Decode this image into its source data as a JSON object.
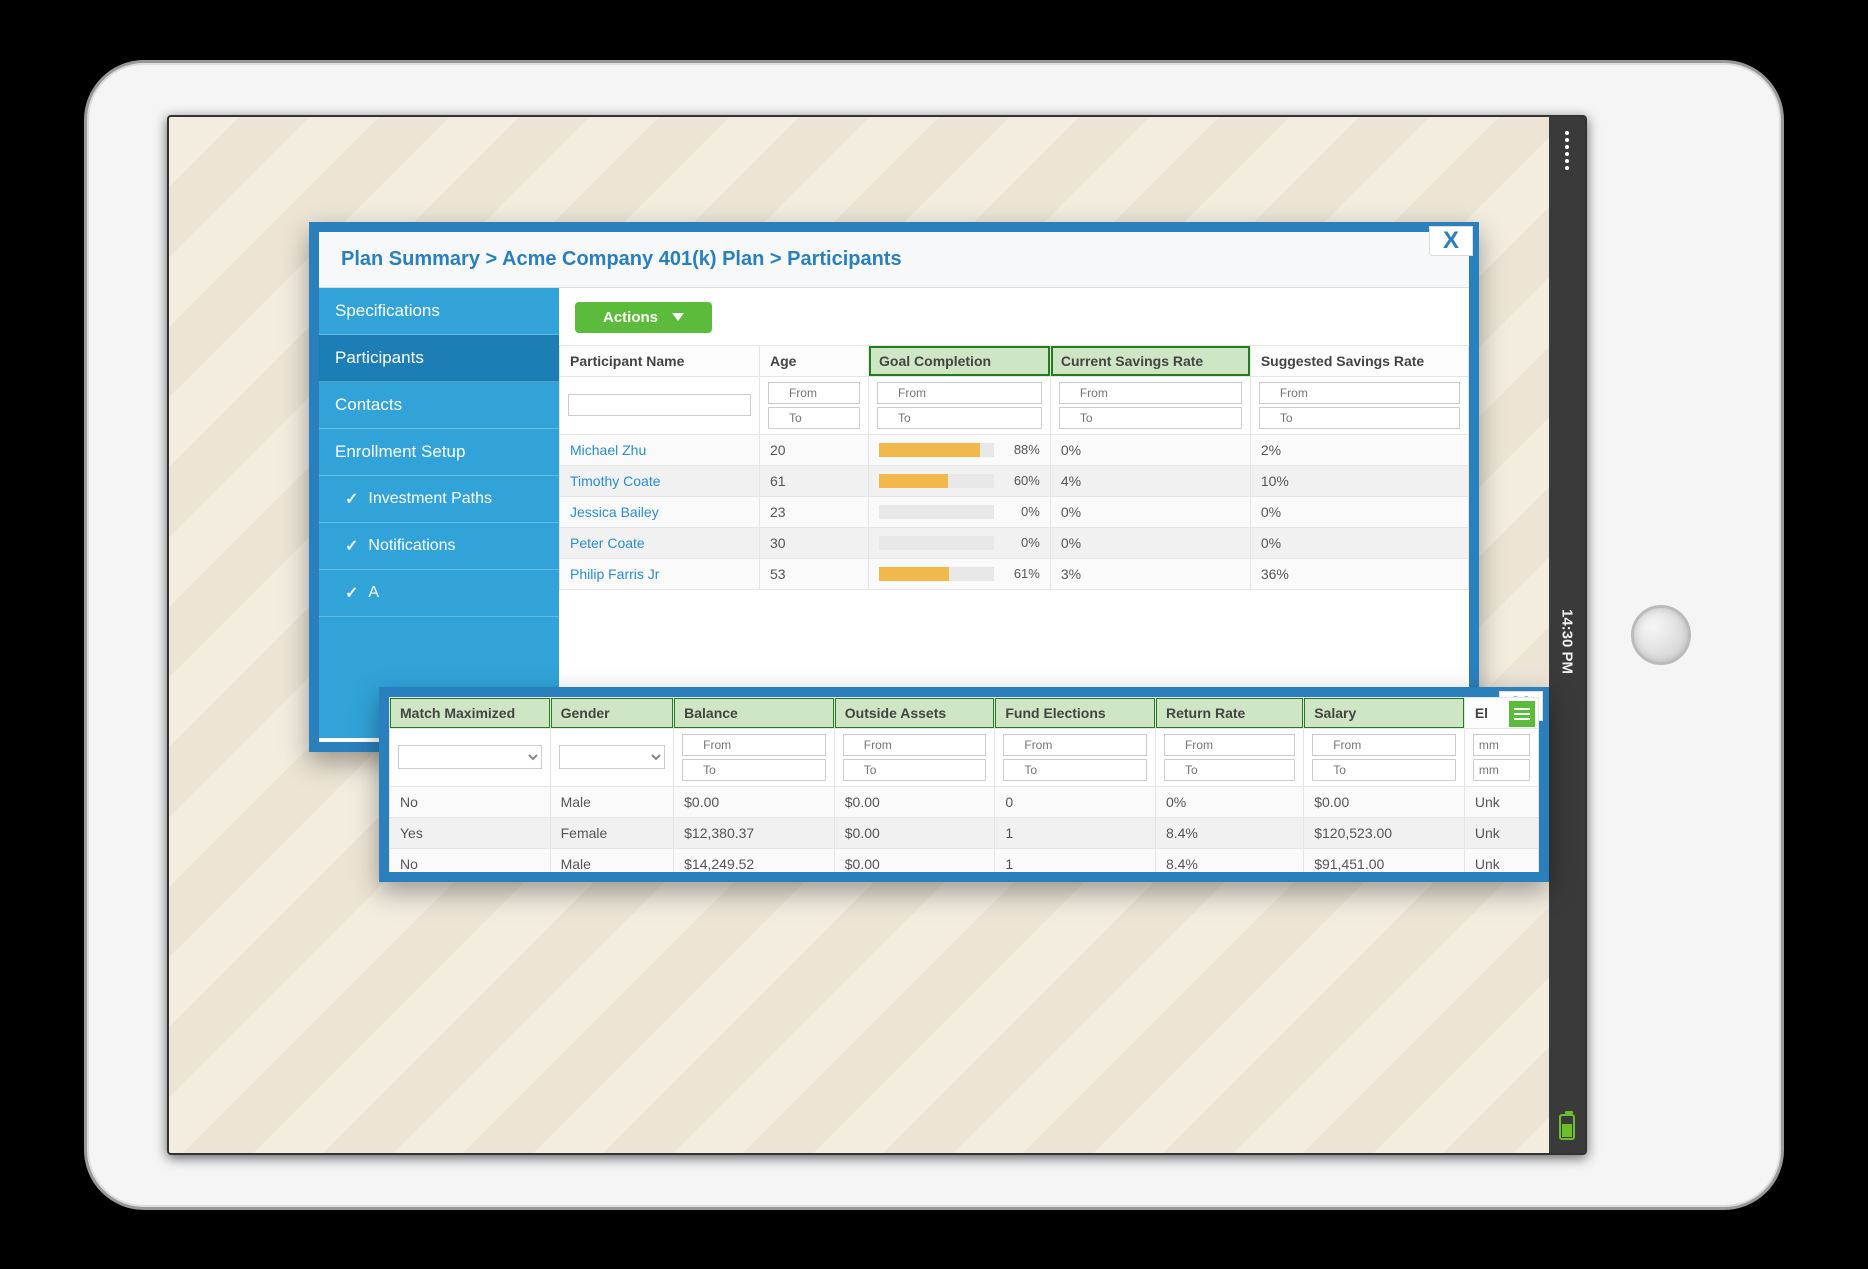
{
  "status": {
    "time": "14:30 PM"
  },
  "window1": {
    "close_label": "X",
    "breadcrumb": "Plan Summary > Acme Company 401(k) Plan > Participants",
    "sidebar": {
      "items": [
        {
          "label": "Specifications"
        },
        {
          "label": "Participants"
        },
        {
          "label": "Contacts"
        },
        {
          "label": "Enrollment Setup"
        },
        {
          "label": "Investment Paths"
        },
        {
          "label": "Notifications"
        },
        {
          "label": "A"
        }
      ]
    },
    "actions_label": "Actions",
    "table": {
      "headers": {
        "name": "Participant Name",
        "age": "Age",
        "goal": "Goal Completion",
        "csr": "Current Savings Rate",
        "ssr": "Suggested Savings Rate"
      },
      "filters": {
        "from": "From",
        "to": "To"
      },
      "rows": [
        {
          "name": "Michael Zhu",
          "age": "20",
          "goal_pct": 88,
          "goal_label": "88%",
          "csr": "0%",
          "ssr": "2%"
        },
        {
          "name": "Timothy Coate",
          "age": "61",
          "goal_pct": 60,
          "goal_label": "60%",
          "csr": "4%",
          "ssr": "10%"
        },
        {
          "name": "Jessica Bailey",
          "age": "23",
          "goal_pct": 0,
          "goal_label": "0%",
          "csr": "0%",
          "ssr": "0%"
        },
        {
          "name": "Peter Coate",
          "age": "30",
          "goal_pct": 0,
          "goal_label": "0%",
          "csr": "0%",
          "ssr": "0%"
        },
        {
          "name": "Philip Farris Jr",
          "age": "53",
          "goal_pct": 61,
          "goal_label": "61%",
          "csr": "3%",
          "ssr": "36%"
        }
      ]
    }
  },
  "window2": {
    "close_label": "X",
    "table": {
      "headers": {
        "match": "Match Maximized",
        "gender": "Gender",
        "balance": "Balance",
        "outside": "Outside Assets",
        "fund": "Fund Elections",
        "rr": "Return Rate",
        "salary": "Salary",
        "el": "El"
      },
      "filters": {
        "from": "From",
        "to": "To",
        "mm": "mm"
      },
      "rows": [
        {
          "match": "No",
          "gender": "Male",
          "balance": "$0.00",
          "outside": "$0.00",
          "fund": "0",
          "rr": "0%",
          "salary": "$0.00",
          "el": "Unk"
        },
        {
          "match": "Yes",
          "gender": "Female",
          "balance": "$12,380.37",
          "outside": "$0.00",
          "fund": "1",
          "rr": "8.4%",
          "salary": "$120,523.00",
          "el": "Unk"
        },
        {
          "match": "No",
          "gender": "Male",
          "balance": "$14,249.52",
          "outside": "$0.00",
          "fund": "1",
          "rr": "8.4%",
          "salary": "$91,451.00",
          "el": "Unk"
        }
      ]
    }
  }
}
